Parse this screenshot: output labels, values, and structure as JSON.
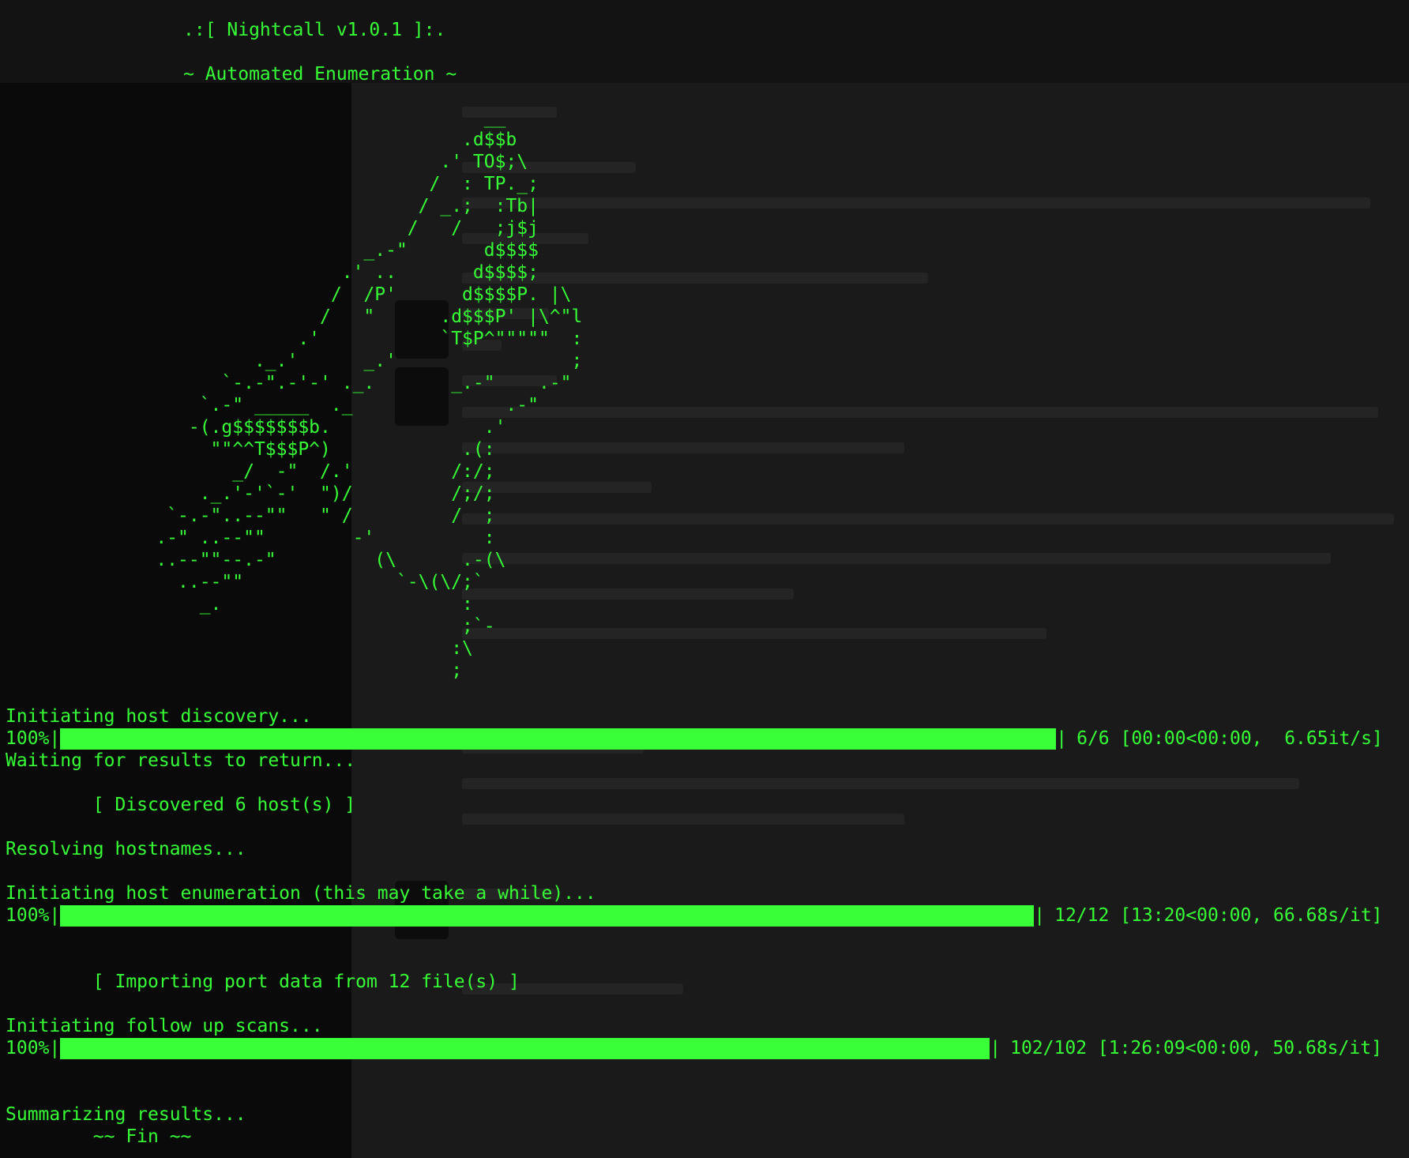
{
  "banner": {
    "title": ".:[ Nightcall v1.0.1 ]:.",
    "subtitle": "~ Automated Enumeration ~"
  },
  "ascii_art": [
    "                                         __",
    "                                       .d$$b",
    "                                     .' TO$;\\",
    "                                    /  : TP._;",
    "                                   / _.;  :Tb|",
    "                                  /   /   ;j$j",
    "                              _.-\"       d$$$$",
    "                            .' ..       d$$$$;",
    "                           /  /P'      d$$$$P. |\\",
    "                          /   \"      .d$$$P' |\\^\"l",
    "                        .'           `T$P^\"\"\"\"\"  :",
    "                    ._.'      _.'                ;",
    "                 `-.-\".-'-' ._.       _.-\"    .-\"",
    "               `.-\" _____  ._              .-\"",
    "              -(.g$$$$$$$b.              .'",
    "                \"\"^^T$$$P^)            .(:",
    "                  _/  -\"  /.'         /:/;",
    "               ._.'-'`-'  \")/         /;/;",
    "            `-.-\"..--\"\"   \" /         /  ;",
    "           .-\" ..--\"\"        -'          :",
    "           ..--\"\"--.-\"         (\\      .-(\\",
    "             ..--\"\"              `-\\(\\/;`",
    "               _.                      :",
    "                                       ;`-",
    "                                      :\\",
    "                                      ;"
  ],
  "log": {
    "host_discovery": "Initiating host discovery...",
    "waiting": "Waiting for results to return...",
    "discovered": "        [ Discovered 6 host(s) ]",
    "resolving": "Resolving hostnames...",
    "host_enum": "Initiating host enumeration (this may take a while)...",
    "importing": "        [ Importing port data from 12 file(s) ]",
    "follow_up": "Initiating follow up scans...",
    "summarizing": "Summarizing results...",
    "fin": "        ~~ Fin ~~"
  },
  "progress": [
    {
      "percent_label": "100%",
      "fill": 1.0,
      "stats": "6/6 [00:00<00:00,  6.65it/s]"
    },
    {
      "percent_label": "100%",
      "fill": 1.0,
      "stats": "12/12 [13:20<00:00, 66.68s/it]"
    },
    {
      "percent_label": "100%",
      "fill": 1.0,
      "stats": "102/102 [1:26:09<00:00, 50.68s/it]"
    }
  ],
  "colors": {
    "terminal_text": "#36ff36",
    "progress_fill": "#39ff39",
    "background": "#161616"
  }
}
